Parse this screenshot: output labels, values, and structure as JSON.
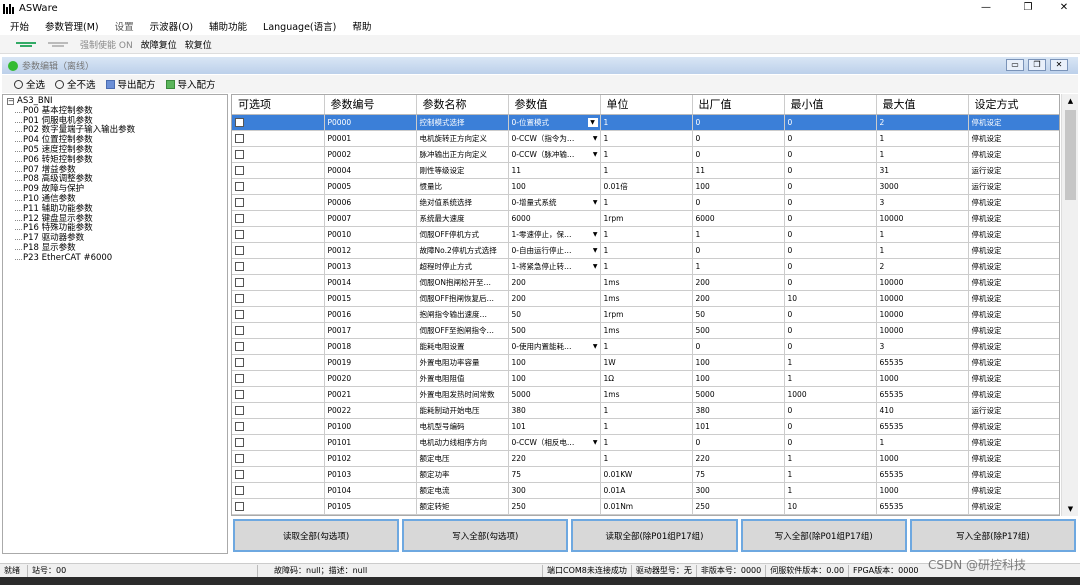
{
  "app": {
    "title": "ASWare"
  },
  "window_controls": {
    "minimize": "—",
    "maximize": "❐",
    "close": "✕"
  },
  "menu": [
    "开始",
    "参数管理(M)",
    "设置",
    "示波器(O)",
    "辅助功能",
    "Language(语言)",
    "帮助"
  ],
  "toolbar": {
    "servo_on": "强制使能 ON",
    "fault_reset": "故障复位",
    "soft_reset": "软复位"
  },
  "child_window": {
    "title": "参数编辑（离线）"
  },
  "actions": {
    "select_all": "全选",
    "deselect_all": "全不选",
    "export": "导出配方",
    "import": "导入配方"
  },
  "tree": {
    "root": "AS3_BNI",
    "items": [
      "P00 基本控制参数",
      "P01 伺服电机参数",
      "P02 数字量端子输入输出参数",
      "P04 位置控制参数",
      "P05 速度控制参数",
      "P06 转矩控制参数",
      "P07 增益参数",
      "P08 高级调整参数",
      "P09 故障与保护",
      "P10 通信参数",
      "P11 辅助功能参数",
      "P12 键盘显示参数",
      "P16 特殊功能参数",
      "P17 驱动器参数",
      "P18 显示参数",
      "P23 EtherCAT #6000"
    ]
  },
  "table": {
    "headers": [
      "可选项",
      "参数编号",
      "参数名称",
      "参数值",
      "单位",
      "出厂值",
      "最小值",
      "最大值",
      "设定方式"
    ],
    "rows": [
      [
        "P0000",
        "控制模式选择",
        "0-位置模式",
        "1",
        "0",
        "0",
        "2",
        "停机设定"
      ],
      [
        "P0001",
        "电机旋转正方向定义",
        "0-CCW（指令为…",
        "1",
        "0",
        "0",
        "1",
        "停机设定"
      ],
      [
        "P0002",
        "脉冲输出正方向定义",
        "0-CCW（脉冲输…",
        "1",
        "0",
        "0",
        "1",
        "停机设定"
      ],
      [
        "P0004",
        "刚性等级设定",
        "11",
        "1",
        "11",
        "0",
        "31",
        "运行设定"
      ],
      [
        "P0005",
        "惯量比",
        "100",
        "0.01倍",
        "100",
        "0",
        "3000",
        "运行设定"
      ],
      [
        "P0006",
        "绝对值系统选择",
        "0-增量式系统",
        "1",
        "0",
        "0",
        "3",
        "停机设定"
      ],
      [
        "P0007",
        "系统最大速度",
        "6000",
        "1rpm",
        "6000",
        "0",
        "10000",
        "停机设定"
      ],
      [
        "P0010",
        "伺服OFF停机方式",
        "1-零速停止，保…",
        "1",
        "1",
        "0",
        "1",
        "停机设定"
      ],
      [
        "P0012",
        "故障No.2停机方式选择",
        "0-自由运行停止…",
        "1",
        "0",
        "0",
        "1",
        "停机设定"
      ],
      [
        "P0013",
        "超程时停止方式",
        "1-将紧急停止转…",
        "1",
        "1",
        "0",
        "2",
        "停机设定"
      ],
      [
        "P0014",
        "伺服ON抱闸松开至…",
        "200",
        "1ms",
        "200",
        "0",
        "10000",
        "停机设定"
      ],
      [
        "P0015",
        "伺服OFF抱闸恢复后…",
        "200",
        "1ms",
        "200",
        "10",
        "10000",
        "停机设定"
      ],
      [
        "P0016",
        "抱闸指令输出速度…",
        "50",
        "1rpm",
        "50",
        "0",
        "10000",
        "停机设定"
      ],
      [
        "P0017",
        "伺服OFF至抱闸指令…",
        "500",
        "1ms",
        "500",
        "0",
        "10000",
        "停机设定"
      ],
      [
        "P0018",
        "能耗电阻设置",
        "0-使用内置能耗…",
        "1",
        "0",
        "0",
        "3",
        "停机设定"
      ],
      [
        "P0019",
        "外置电阻功率容量",
        "100",
        "1W",
        "100",
        "1",
        "65535",
        "停机设定"
      ],
      [
        "P0020",
        "外置电阻阻值",
        "100",
        "1Ω",
        "100",
        "1",
        "1000",
        "停机设定"
      ],
      [
        "P0021",
        "外置电阻发热时间常数",
        "5000",
        "1ms",
        "5000",
        "1000",
        "65535",
        "停机设定"
      ],
      [
        "P0022",
        "能耗制动开始电压",
        "380",
        "1",
        "380",
        "0",
        "410",
        "运行设定"
      ],
      [
        "P0100",
        "电机型号编码",
        "101",
        "1",
        "101",
        "0",
        "65535",
        "停机设定"
      ],
      [
        "P0101",
        "电机动力线相序方向",
        "0-CCW（相反电…",
        "1",
        "0",
        "0",
        "1",
        "停机设定"
      ],
      [
        "P0102",
        "额定电压",
        "220",
        "1",
        "220",
        "1",
        "1000",
        "停机设定"
      ],
      [
        "P0103",
        "额定功率",
        "75",
        "0.01KW",
        "75",
        "1",
        "65535",
        "停机设定"
      ],
      [
        "P0104",
        "额定电流",
        "300",
        "0.01A",
        "300",
        "1",
        "1000",
        "停机设定"
      ],
      [
        "P0105",
        "额定转矩",
        "250",
        "0.01Nm",
        "250",
        "10",
        "65535",
        "停机设定"
      ]
    ]
  },
  "buttons": [
    "读取全部(勾选项)",
    "写入全部(勾选项)",
    "读取全部(除P01组P17组)",
    "写入全部(除P01组P17组)",
    "写入全部(除P17组)"
  ],
  "status": {
    "ready": "就绪",
    "station": "站号：00",
    "fault": "故障码：null；描述：null",
    "port": "端口COM8未连接成功",
    "drive_model": "驱动器型号：无",
    "version": "非版本号：0000",
    "servo_sw": "伺服软件版本：0.00",
    "fpga": "FPGA版本：0000"
  },
  "watermark": "CSDN @研控科技"
}
